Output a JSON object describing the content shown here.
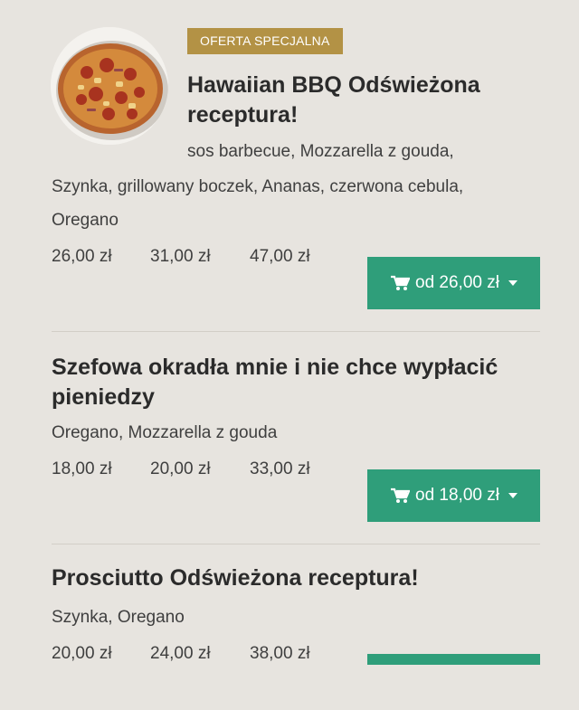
{
  "items": [
    {
      "badge": "OFERTA SPECJALNA",
      "title_line1": "Hawaiian BBQ Odświeżona",
      "title_line2": "receptura!",
      "desc_line1": "sos barbecue, Mozzarella z gouda,",
      "desc_line2": "Szynka, grillowany boczek, Ananas, czerwona cebula,",
      "desc_line3": "Oregano",
      "prices": [
        "26,00 zł",
        "31,00 zł",
        "47,00 zł"
      ],
      "button_label": "od 26,00 zł"
    },
    {
      "title_line1": "Szefowa okradła mnie i nie chce wypłacić",
      "title_line2": "pieniedzy",
      "desc_line1": "Oregano, Mozzarella z gouda",
      "prices": [
        "18,00 zł",
        "20,00 zł",
        "33,00 zł"
      ],
      "button_label": "od 18,00 zł"
    },
    {
      "title_line1": "Prosciutto Odświeżona receptura!",
      "desc_line1": "Szynka, Oregano",
      "prices": [
        "20,00 zł",
        "24,00 zł",
        "38,00 zł"
      ]
    }
  ],
  "colors": {
    "badge": "#b39245",
    "button": "#2f9e7a",
    "background": "#e7e4df"
  },
  "icons": {
    "cart": "shopping-cart-icon",
    "caret": "caret-down-icon"
  }
}
